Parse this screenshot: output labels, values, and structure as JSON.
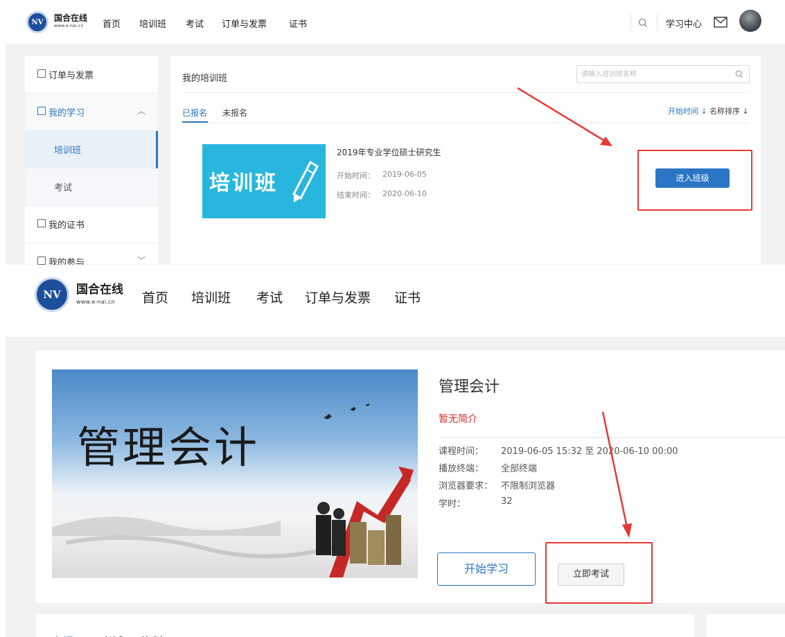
{
  "top": {
    "brand": {
      "name": "国合在线",
      "url": "www.e-nai.cn",
      "logo_text": "NV"
    },
    "nav": [
      "首页",
      "培训班",
      "考试",
      "订单与发票",
      "证书"
    ],
    "header_right": {
      "learning_center": "学习中心"
    },
    "sidebar": {
      "orders": "订单与发票",
      "my_learning": "我的学习",
      "training": "培训班",
      "exam": "考试",
      "certificates": "我的证书",
      "participation": "我的参与"
    },
    "main": {
      "title": "我的培训班",
      "search_placeholder": "请输入培训班名称",
      "tabs": {
        "enrolled": "已报名",
        "not_enrolled": "未报名"
      },
      "sort": {
        "by_start": "开始时间 ↓",
        "by_name": "名称排序 ↓"
      },
      "course": {
        "thumbnail_text": "培训班",
        "title": "2019年专业学位硕士研究生",
        "start_label": "开始时间：",
        "start_date": "2019-06-05",
        "end_label": "结束时间：",
        "end_date": "2020-06-10"
      },
      "enter_button": "进入班级"
    }
  },
  "bottom": {
    "brand": {
      "name": "国合在线",
      "url": "www.e-nai.cn",
      "logo_text": "NV"
    },
    "nav": [
      "首页",
      "培训班",
      "考试",
      "订单与发票",
      "证书"
    ],
    "course": {
      "image_text": "管理会计",
      "title": "管理会计",
      "intro": "暂无简介",
      "time_label": "课程时间：",
      "time_value": "2019-06-05 15:32 至 2020-06-10 00:00",
      "terminal_label": "播放终端：",
      "terminal_value": "全部终端",
      "browser_label": "浏览器要求：",
      "browser_value": "不限制浏览器",
      "hours_label": "学时：",
      "hours_value": "32",
      "start_button": "开始学习",
      "exam_button": "立即考试"
    },
    "tabs_partial": [
      "大纲",
      "考试",
      "资料"
    ]
  },
  "colors": {
    "accent_blue": "#2b76c4",
    "annotation_red": "#e53935",
    "intro_red": "#d32f2f",
    "background_gray": "#f2f2f2"
  }
}
